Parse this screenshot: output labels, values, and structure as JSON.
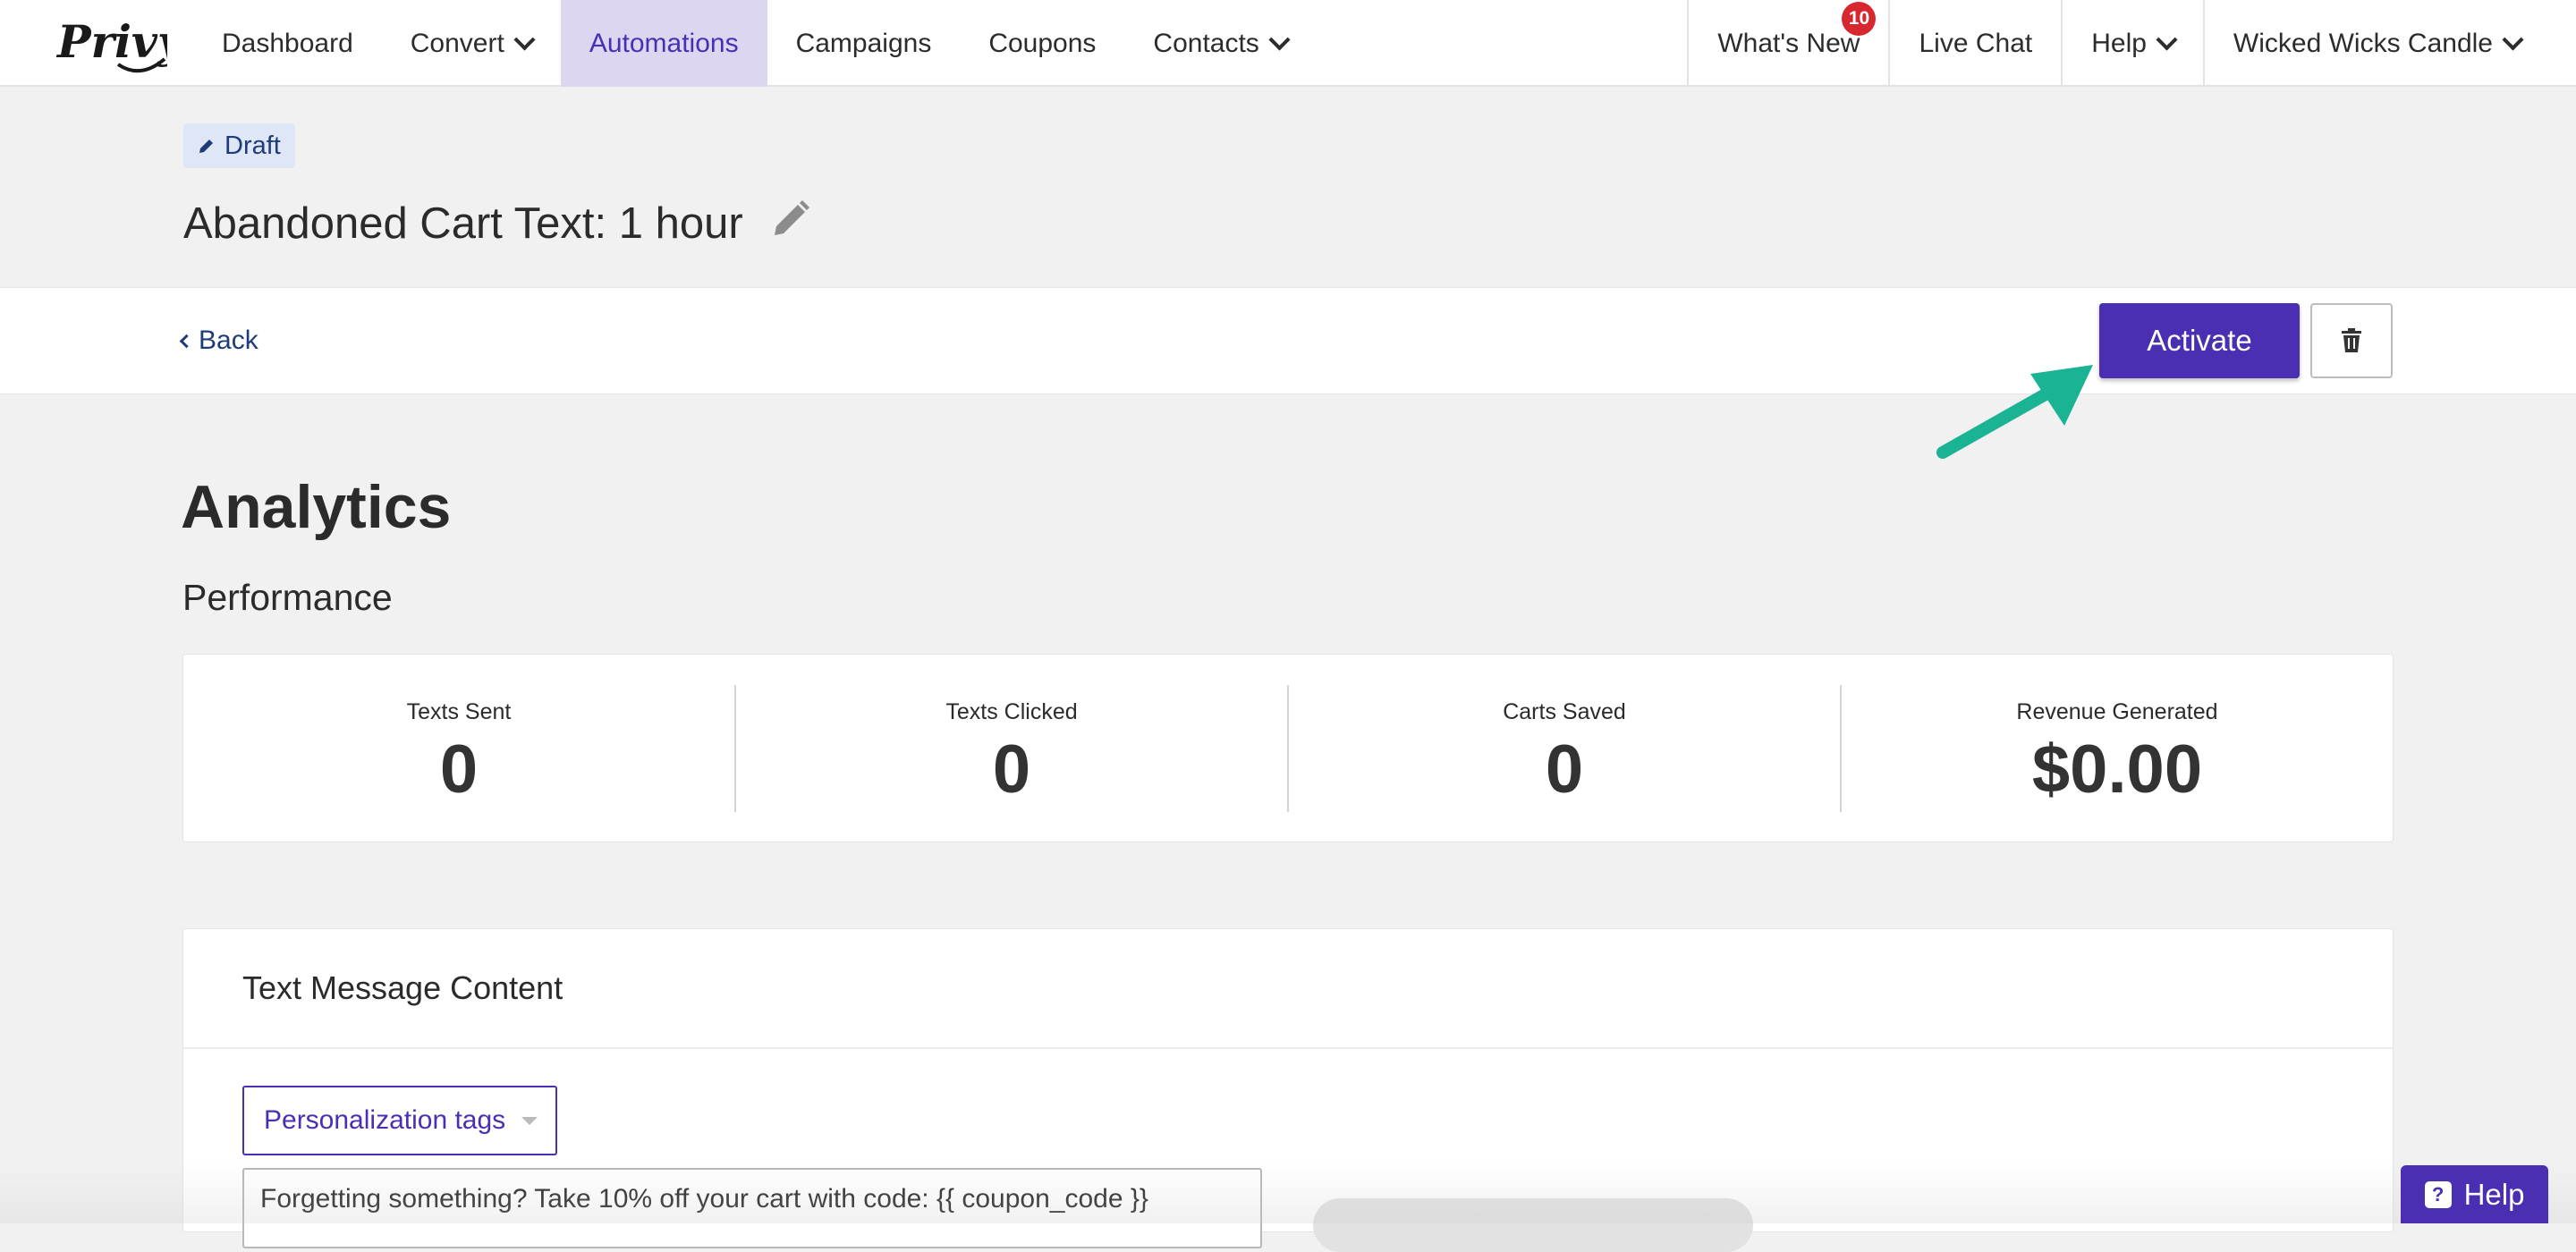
{
  "nav": {
    "logo": "Privy",
    "items": [
      {
        "label": "Dashboard"
      },
      {
        "label": "Convert"
      },
      {
        "label": "Automations"
      },
      {
        "label": "Campaigns"
      },
      {
        "label": "Coupons"
      },
      {
        "label": "Contacts"
      }
    ],
    "right": {
      "whats_new": "What's New",
      "whats_new_count": "10",
      "live_chat": "Live Chat",
      "help": "Help",
      "account": "Wicked Wicks Candle"
    },
    "active_color": "#dcd6f1"
  },
  "header": {
    "status": "Draft",
    "title": "Abandoned Cart Text: 1 hour"
  },
  "actions": {
    "back": "Back",
    "activate": "Activate",
    "delete_icon": "trash-icon"
  },
  "analytics": {
    "title": "Analytics",
    "performance_title": "Performance",
    "stats": [
      {
        "label": "Texts Sent",
        "value": "0"
      },
      {
        "label": "Texts Clicked",
        "value": "0"
      },
      {
        "label": "Carts Saved",
        "value": "0"
      },
      {
        "label": "Revenue Generated",
        "value": "$0.00"
      }
    ]
  },
  "content": {
    "title": "Text Message Content",
    "personalization_tags": "Personalization tags",
    "message": "Forgetting something? Take 10% off your cart with code: {{ coupon_code }}"
  },
  "help_widget": {
    "label": "Help"
  },
  "colors": {
    "brand": "#4a2fb3",
    "annotation_arrow": "#1ab394",
    "badge": "#d7282f"
  }
}
